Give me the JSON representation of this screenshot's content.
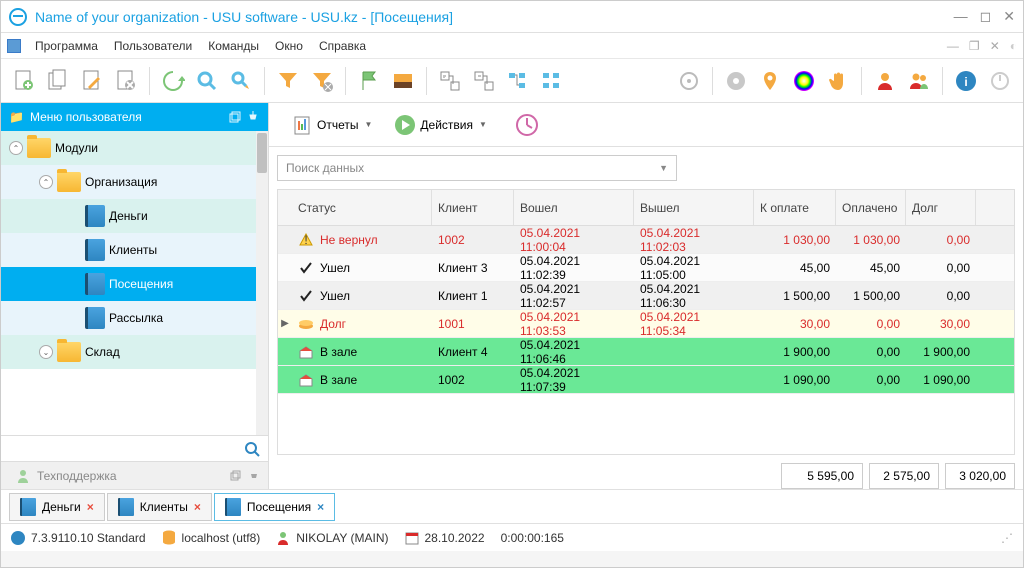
{
  "window": {
    "title": "Name of your organization - USU software - USU.kz - [Посещения]"
  },
  "menu": {
    "items": [
      "Программа",
      "Пользователи",
      "Команды",
      "Окно",
      "Справка"
    ]
  },
  "sidebar": {
    "title": "Меню пользователя",
    "items": [
      {
        "label": "Модули"
      },
      {
        "label": "Организация"
      },
      {
        "label": "Деньги"
      },
      {
        "label": "Клиенты"
      },
      {
        "label": "Посещения"
      },
      {
        "label": "Рассылка"
      },
      {
        "label": "Склад"
      }
    ],
    "support": "Техподдержка"
  },
  "subtoolbar": {
    "reports": "Отчеты",
    "actions": "Действия"
  },
  "search": {
    "placeholder": "Поиск данных"
  },
  "table": {
    "headers": {
      "status": "Статус",
      "client": "Клиент",
      "in": "Вошел",
      "out": "Вышел",
      "topay": "К оплате",
      "paid": "Оплачено",
      "debt": "Долг"
    },
    "rows": [
      {
        "cls": "gray",
        "icon": "warn",
        "red": true,
        "status": "Не вернул",
        "client": "1002",
        "in": "05.04.2021 11:00:04",
        "out": "05.04.2021 11:02:03",
        "topay": "1 030,00",
        "paid": "1 030,00",
        "debt": "0,00"
      },
      {
        "cls": "white",
        "icon": "check",
        "red": false,
        "status": "Ушел",
        "client": "Клиент 3",
        "in": "05.04.2021 11:02:39",
        "out": "05.04.2021 11:05:00",
        "topay": "45,00",
        "paid": "45,00",
        "debt": "0,00"
      },
      {
        "cls": "gray",
        "icon": "check",
        "red": false,
        "status": "Ушел",
        "client": "Клиент 1",
        "in": "05.04.2021 11:02:57",
        "out": "05.04.2021 11:06:30",
        "topay": "1 500,00",
        "paid": "1 500,00",
        "debt": "0,00"
      },
      {
        "cls": "yellow",
        "icon": "debt",
        "red": true,
        "ind": "▶",
        "status": "Долг",
        "client": "1001",
        "in": "05.04.2021 11:03:53",
        "out": "05.04.2021 11:05:34",
        "topay": "30,00",
        "paid": "0,00",
        "debt": "30,00",
        "debtred": true
      },
      {
        "cls": "green",
        "icon": "hall",
        "red": false,
        "status": "В зале",
        "client": "Клиент 4",
        "in": "05.04.2021 11:06:46",
        "out": "",
        "topay": "1 900,00",
        "paid": "0,00",
        "debt": "1 900,00"
      },
      {
        "cls": "green",
        "icon": "hall",
        "red": false,
        "status": "В зале",
        "client": "1002",
        "in": "05.04.2021 11:07:39",
        "out": "",
        "topay": "1 090,00",
        "paid": "0,00",
        "debt": "1 090,00"
      }
    ],
    "totals": {
      "topay": "5 595,00",
      "paid": "2 575,00",
      "debt": "3 020,00"
    }
  },
  "tabs": [
    {
      "label": "Деньги",
      "active": false
    },
    {
      "label": "Клиенты",
      "active": false
    },
    {
      "label": "Посещения",
      "active": true
    }
  ],
  "status": {
    "version": "7.3.9110.10 Standard",
    "host": "localhost (utf8)",
    "user": "NIKOLAY (MAIN)",
    "date": "28.10.2022",
    "time": "0:00:00:165"
  }
}
